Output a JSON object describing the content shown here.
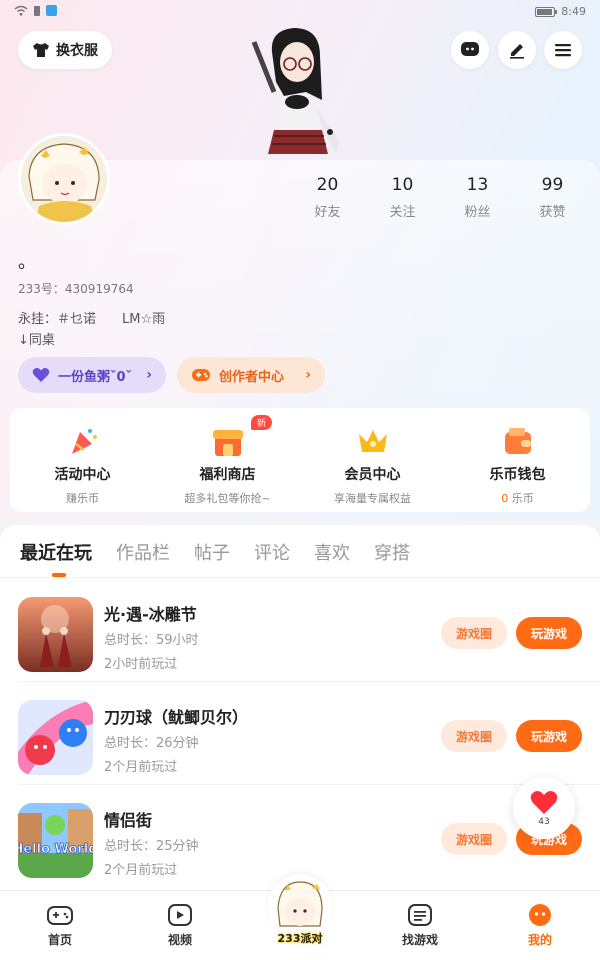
{
  "status_bar": {
    "time": "8:49",
    "battery_percent": 90
  },
  "header": {
    "outfit_label": "换衣服",
    "icons": [
      "chat-bubble-icon",
      "pencil-icon",
      "menu-icon"
    ]
  },
  "stats": [
    {
      "num": "20",
      "label": "好友"
    },
    {
      "num": "10",
      "label": "关注"
    },
    {
      "num": "13",
      "label": "粉丝"
    },
    {
      "num": "99",
      "label": "获赞"
    }
  ],
  "profile": {
    "nickname": "。",
    "uid": "233号：430919764",
    "bio_line1": "永挂：＃乜诺　　LM☆雨",
    "bio_line2": "↓同桌"
  },
  "pills": {
    "fish": "一份鱼粥ˇ0ˇ",
    "creator": "创作者中心"
  },
  "services": [
    {
      "title": "活动中心",
      "sub": "赚乐币",
      "icon": "party-popper-icon"
    },
    {
      "title": "福利商店",
      "sub": "超多礼包等你抢~",
      "icon": "shop-icon",
      "badge": "新"
    },
    {
      "title": "会员中心",
      "sub": "享海量专属权益",
      "icon": "crown-icon"
    },
    {
      "title": "乐币钱包",
      "sub_value": "0",
      "sub_unit": " 乐币",
      "icon": "wallet-icon"
    }
  ],
  "tabs": [
    "最近在玩",
    "作品栏",
    "帖子",
    "评论",
    "喜欢",
    "穿搭"
  ],
  "games": [
    {
      "name": "光·遇-冰雕节",
      "time": "总时长：59小时",
      "ago": "2小时前玩过",
      "circle": "游戏圈",
      "play": "玩游戏"
    },
    {
      "name": "刀刃球（鱿鲫贝尔）",
      "time": "总时长：26分钟",
      "ago": "2个月前玩过",
      "circle": "游戏圈",
      "play": "玩游戏"
    },
    {
      "name": "情侣街",
      "time": "总时长：25分钟",
      "ago": "2个月前玩过",
      "circle": "游戏圈",
      "play": "玩游戏"
    }
  ],
  "hello_world_text": "Hello World",
  "like_count": "43",
  "nav": [
    {
      "label": "首页",
      "icon": "gamepad-icon"
    },
    {
      "label": "视频",
      "icon": "video-play-icon"
    },
    {
      "label": "找游戏",
      "icon": "list-icon"
    },
    {
      "label": "我的",
      "icon": "profile-face-icon",
      "active": true
    }
  ],
  "nav_center_label": "233派对",
  "colors": {
    "accent": "#ff6a14",
    "purple": "#5b44c4",
    "red_badge": "#ff4a3d"
  }
}
